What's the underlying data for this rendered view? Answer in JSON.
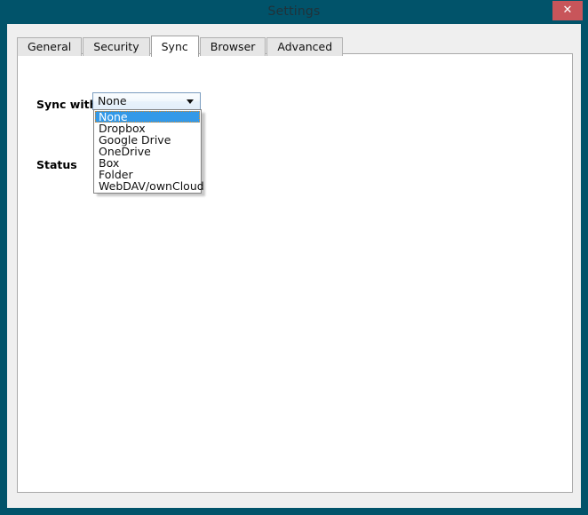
{
  "window": {
    "title": "Settings",
    "close_label": "✕",
    "accent_teal": "#01536a",
    "close_button_color": "#c8555a"
  },
  "tabs": [
    {
      "label": "General",
      "active": false
    },
    {
      "label": "Security",
      "active": false
    },
    {
      "label": "Sync",
      "active": true
    },
    {
      "label": "Browser",
      "active": false
    },
    {
      "label": "Advanced",
      "active": false
    }
  ],
  "sync_panel": {
    "sync_with_label": "Sync with",
    "status_label": "Status",
    "status_value": "",
    "combobox": {
      "selected": "None",
      "expanded": true,
      "highlight_color": "#3399e8",
      "options": [
        {
          "label": "None",
          "selected": true
        },
        {
          "label": "Dropbox",
          "selected": false
        },
        {
          "label": "Google Drive",
          "selected": false
        },
        {
          "label": "OneDrive",
          "selected": false
        },
        {
          "label": "Box",
          "selected": false
        },
        {
          "label": "Folder",
          "selected": false
        },
        {
          "label": "WebDAV/ownCloud",
          "selected": false
        }
      ]
    }
  }
}
